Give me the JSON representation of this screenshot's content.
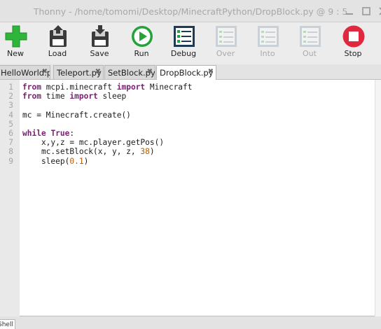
{
  "window": {
    "title": "Thonny  -  /home/tomomi/Desktop/MinecraftPython/DropBlock.py  @  9 : 5"
  },
  "toolbar": {
    "items": [
      {
        "label": "New",
        "icon": "plus-icon",
        "enabled": true
      },
      {
        "label": "Load",
        "icon": "load-floppy-icon",
        "enabled": true
      },
      {
        "label": "Save",
        "icon": "save-floppy-icon",
        "enabled": true
      },
      {
        "label": "Run",
        "icon": "play-icon",
        "enabled": true
      },
      {
        "label": "Debug",
        "icon": "debug-icon",
        "enabled": true
      },
      {
        "label": "Over",
        "icon": "step-over-icon",
        "enabled": false
      },
      {
        "label": "Into",
        "icon": "step-into-icon",
        "enabled": false
      },
      {
        "label": "Out",
        "icon": "step-out-icon",
        "enabled": false
      },
      {
        "label": "Stop",
        "icon": "stop-icon",
        "enabled": true
      }
    ]
  },
  "tabs": [
    {
      "label": "HelloWorld.py",
      "active": false
    },
    {
      "label": "Teleport.py",
      "active": false
    },
    {
      "label": "SetBlock.py",
      "active": false
    },
    {
      "label": "DropBlock.py *",
      "active": true
    }
  ],
  "editor": {
    "line_numbers": [
      "1",
      "2",
      "3",
      "4",
      "5",
      "6",
      "7",
      "8",
      "9"
    ],
    "lines": [
      [
        {
          "t": "from",
          "c": "kw"
        },
        {
          "t": " mcpi.minecraft "
        },
        {
          "t": "import",
          "c": "kw"
        },
        {
          "t": " Minecraft"
        }
      ],
      [
        {
          "t": "from",
          "c": "kw"
        },
        {
          "t": " time "
        },
        {
          "t": "import",
          "c": "kw"
        },
        {
          "t": " sleep"
        }
      ],
      [],
      [
        {
          "t": "mc = Minecraft.create()"
        }
      ],
      [],
      [
        {
          "t": "while",
          "c": "kw"
        },
        {
          "t": " "
        },
        {
          "t": "True",
          "c": "kw"
        },
        {
          "t": ":"
        }
      ],
      [
        {
          "t": "    x,y,z = mc.player.getPos()"
        }
      ],
      [
        {
          "t": "    mc.setBlock(x, y, z, "
        },
        {
          "t": "38",
          "c": "num"
        },
        {
          "t": ")"
        }
      ],
      [
        {
          "t": "    sleep("
        },
        {
          "t": "0.1",
          "c": "num"
        },
        {
          "t": ")"
        }
      ]
    ]
  },
  "bottom": {
    "shell_tab": "Shell"
  },
  "colors": {
    "keyword": "#7a1f74",
    "number": "#b35c00",
    "new_green": "#2fb53a",
    "run_green": "#25a23a",
    "stop_red": "#e0283f"
  }
}
